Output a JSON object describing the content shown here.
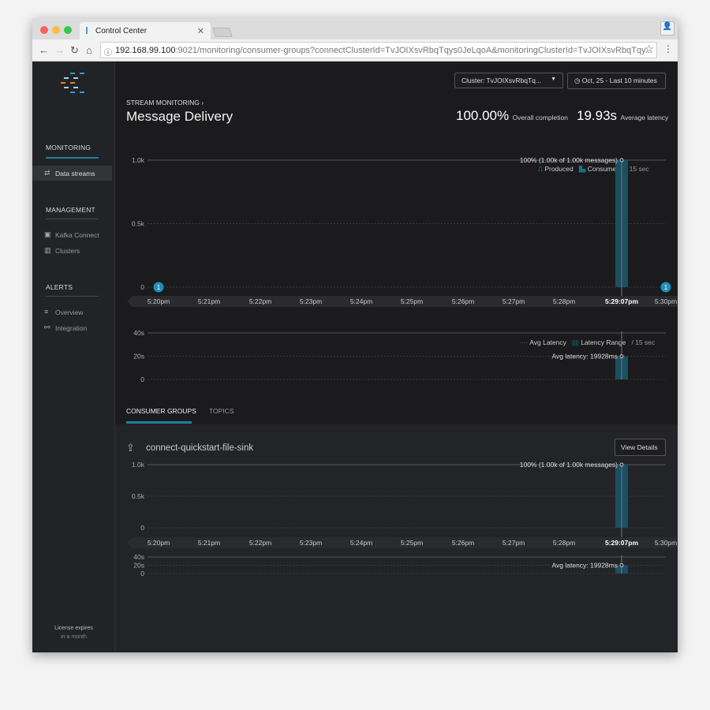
{
  "browser": {
    "tab_title": "Control Center",
    "url_host": "192.168.99.100",
    "url_rest": ":9021/monitoring/consumer-groups?connectClusterId=TvJOIXsvRbqTqys0JeLqoA&monitoringClusterId=TvJOIXsvRbqTqy..."
  },
  "sidebar": {
    "sections": [
      {
        "title": "MONITORING",
        "items": [
          {
            "label": "Data streams",
            "icon": "arrows-icon",
            "active": true
          }
        ]
      },
      {
        "title": "MANAGEMENT",
        "items": [
          {
            "label": "Kafka Connect",
            "icon": "connect-icon"
          },
          {
            "label": "Clusters",
            "icon": "clusters-icon"
          }
        ]
      },
      {
        "title": "ALERTS",
        "items": [
          {
            "label": "Overview",
            "icon": "list-icon"
          },
          {
            "label": "Integration",
            "icon": "integration-icon"
          }
        ]
      }
    ],
    "license_line1": "License expires",
    "license_line2": "in a month"
  },
  "header": {
    "breadcrumb": "STREAM MONITORING",
    "title": "Message Delivery",
    "cluster_select": "Cluster: TvJOIXsvRbqTq...",
    "time_range": "Oct, 25 - Last 10 minutes",
    "completion_value": "100.00%",
    "completion_label": "Overall completion",
    "latency_value": "19.93s",
    "latency_label": "Average latency"
  },
  "colors": {
    "accent": "#1f7fa6",
    "bar": "#1b4f63",
    "sidebar": "#222326",
    "background": "#1b1b1d"
  },
  "tabs": [
    {
      "label": "CONSUMER GROUPS",
      "active": true
    },
    {
      "label": "TOPICS"
    }
  ],
  "consumer_group": {
    "name": "connect-quickstart-file-sink",
    "view_details": "View Details"
  },
  "chart_data": [
    {
      "type": "bar",
      "legend": [
        "Produced",
        "Consumed"
      ],
      "interval": "/ 15 sec",
      "x_ticks": [
        "5:20pm",
        "5:21pm",
        "5:22pm",
        "5:23pm",
        "5:24pm",
        "5:25pm",
        "5:26pm",
        "5:27pm",
        "5:28pm",
        "5:29:07pm",
        "5:30pm"
      ],
      "y_ticks": [
        "0",
        "0.5k",
        "1.0k"
      ],
      "ylim": [
        0,
        1000
      ],
      "bars": [
        {
          "x": "5:29:07pm",
          "value": 1000
        }
      ],
      "annotation": "100% (1.00k of 1.00k messages)",
      "markers": [
        {
          "x": "5:20pm",
          "label": "1"
        },
        {
          "x": "5:30pm",
          "label": "1"
        }
      ]
    },
    {
      "type": "bar",
      "legend": [
        "Avg Latency",
        "Latency Range"
      ],
      "interval": "/ 15 sec",
      "y_ticks": [
        "0",
        "20s",
        "40s"
      ],
      "ylim": [
        0,
        40
      ],
      "bars": [
        {
          "x": "5:29:07pm",
          "value": 19.928
        }
      ],
      "annotation": "Avg latency: 19928ms"
    },
    {
      "type": "bar",
      "x_ticks": [
        "5:20pm",
        "5:21pm",
        "5:22pm",
        "5:23pm",
        "5:24pm",
        "5:25pm",
        "5:26pm",
        "5:27pm",
        "5:28pm",
        "5:29:07pm",
        "5:30pm"
      ],
      "y_ticks": [
        "0",
        "0.5k",
        "1.0k"
      ],
      "ylim": [
        0,
        1000
      ],
      "bars": [
        {
          "x": "5:29:07pm",
          "value": 1000
        }
      ],
      "annotation": "100% (1.00k of 1.00k messages)"
    },
    {
      "type": "bar",
      "y_ticks": [
        "0",
        "20s",
        "40s"
      ],
      "ylim": [
        0,
        40
      ],
      "bars": [
        {
          "x": "5:29:07pm",
          "value": 19.928
        }
      ],
      "annotation": "Avg latency: 19928ms"
    }
  ]
}
